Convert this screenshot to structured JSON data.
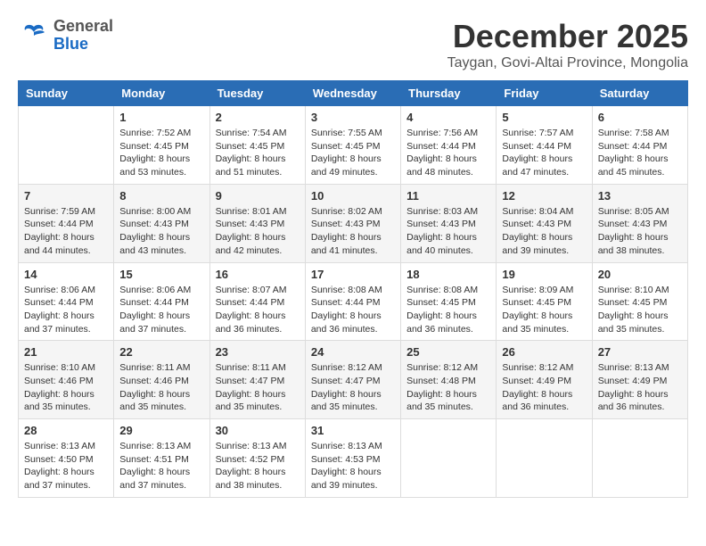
{
  "header": {
    "logo_general": "General",
    "logo_blue": "Blue",
    "month_title": "December 2025",
    "location": "Taygan, Govi-Altai Province, Mongolia"
  },
  "days_of_week": [
    "Sunday",
    "Monday",
    "Tuesday",
    "Wednesday",
    "Thursday",
    "Friday",
    "Saturday"
  ],
  "weeks": [
    [
      {
        "day": "",
        "info": ""
      },
      {
        "day": "1",
        "info": "Sunrise: 7:52 AM\nSunset: 4:45 PM\nDaylight: 8 hours\nand 53 minutes."
      },
      {
        "day": "2",
        "info": "Sunrise: 7:54 AM\nSunset: 4:45 PM\nDaylight: 8 hours\nand 51 minutes."
      },
      {
        "day": "3",
        "info": "Sunrise: 7:55 AM\nSunset: 4:45 PM\nDaylight: 8 hours\nand 49 minutes."
      },
      {
        "day": "4",
        "info": "Sunrise: 7:56 AM\nSunset: 4:44 PM\nDaylight: 8 hours\nand 48 minutes."
      },
      {
        "day": "5",
        "info": "Sunrise: 7:57 AM\nSunset: 4:44 PM\nDaylight: 8 hours\nand 47 minutes."
      },
      {
        "day": "6",
        "info": "Sunrise: 7:58 AM\nSunset: 4:44 PM\nDaylight: 8 hours\nand 45 minutes."
      }
    ],
    [
      {
        "day": "7",
        "info": "Sunrise: 7:59 AM\nSunset: 4:44 PM\nDaylight: 8 hours\nand 44 minutes."
      },
      {
        "day": "8",
        "info": "Sunrise: 8:00 AM\nSunset: 4:43 PM\nDaylight: 8 hours\nand 43 minutes."
      },
      {
        "day": "9",
        "info": "Sunrise: 8:01 AM\nSunset: 4:43 PM\nDaylight: 8 hours\nand 42 minutes."
      },
      {
        "day": "10",
        "info": "Sunrise: 8:02 AM\nSunset: 4:43 PM\nDaylight: 8 hours\nand 41 minutes."
      },
      {
        "day": "11",
        "info": "Sunrise: 8:03 AM\nSunset: 4:43 PM\nDaylight: 8 hours\nand 40 minutes."
      },
      {
        "day": "12",
        "info": "Sunrise: 8:04 AM\nSunset: 4:43 PM\nDaylight: 8 hours\nand 39 minutes."
      },
      {
        "day": "13",
        "info": "Sunrise: 8:05 AM\nSunset: 4:43 PM\nDaylight: 8 hours\nand 38 minutes."
      }
    ],
    [
      {
        "day": "14",
        "info": "Sunrise: 8:06 AM\nSunset: 4:44 PM\nDaylight: 8 hours\nand 37 minutes."
      },
      {
        "day": "15",
        "info": "Sunrise: 8:06 AM\nSunset: 4:44 PM\nDaylight: 8 hours\nand 37 minutes."
      },
      {
        "day": "16",
        "info": "Sunrise: 8:07 AM\nSunset: 4:44 PM\nDaylight: 8 hours\nand 36 minutes."
      },
      {
        "day": "17",
        "info": "Sunrise: 8:08 AM\nSunset: 4:44 PM\nDaylight: 8 hours\nand 36 minutes."
      },
      {
        "day": "18",
        "info": "Sunrise: 8:08 AM\nSunset: 4:45 PM\nDaylight: 8 hours\nand 36 minutes."
      },
      {
        "day": "19",
        "info": "Sunrise: 8:09 AM\nSunset: 4:45 PM\nDaylight: 8 hours\nand 35 minutes."
      },
      {
        "day": "20",
        "info": "Sunrise: 8:10 AM\nSunset: 4:45 PM\nDaylight: 8 hours\nand 35 minutes."
      }
    ],
    [
      {
        "day": "21",
        "info": "Sunrise: 8:10 AM\nSunset: 4:46 PM\nDaylight: 8 hours\nand 35 minutes."
      },
      {
        "day": "22",
        "info": "Sunrise: 8:11 AM\nSunset: 4:46 PM\nDaylight: 8 hours\nand 35 minutes."
      },
      {
        "day": "23",
        "info": "Sunrise: 8:11 AM\nSunset: 4:47 PM\nDaylight: 8 hours\nand 35 minutes."
      },
      {
        "day": "24",
        "info": "Sunrise: 8:12 AM\nSunset: 4:47 PM\nDaylight: 8 hours\nand 35 minutes."
      },
      {
        "day": "25",
        "info": "Sunrise: 8:12 AM\nSunset: 4:48 PM\nDaylight: 8 hours\nand 35 minutes."
      },
      {
        "day": "26",
        "info": "Sunrise: 8:12 AM\nSunset: 4:49 PM\nDaylight: 8 hours\nand 36 minutes."
      },
      {
        "day": "27",
        "info": "Sunrise: 8:13 AM\nSunset: 4:49 PM\nDaylight: 8 hours\nand 36 minutes."
      }
    ],
    [
      {
        "day": "28",
        "info": "Sunrise: 8:13 AM\nSunset: 4:50 PM\nDaylight: 8 hours\nand 37 minutes."
      },
      {
        "day": "29",
        "info": "Sunrise: 8:13 AM\nSunset: 4:51 PM\nDaylight: 8 hours\nand 37 minutes."
      },
      {
        "day": "30",
        "info": "Sunrise: 8:13 AM\nSunset: 4:52 PM\nDaylight: 8 hours\nand 38 minutes."
      },
      {
        "day": "31",
        "info": "Sunrise: 8:13 AM\nSunset: 4:53 PM\nDaylight: 8 hours\nand 39 minutes."
      },
      {
        "day": "",
        "info": ""
      },
      {
        "day": "",
        "info": ""
      },
      {
        "day": "",
        "info": ""
      }
    ]
  ]
}
